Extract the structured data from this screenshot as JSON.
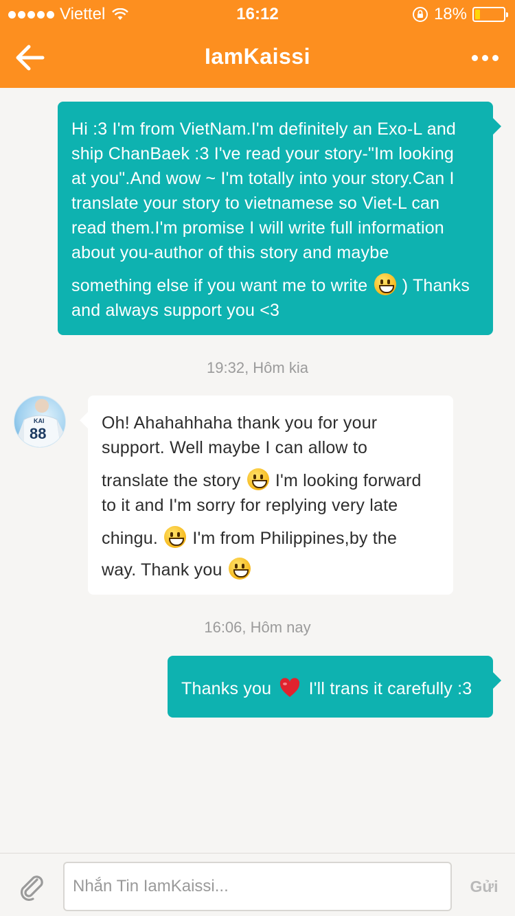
{
  "status_bar": {
    "carrier": "Viettel",
    "time": "16:12",
    "battery": "18%",
    "battery_level": 0.18
  },
  "header": {
    "title": "IamKaissi",
    "back_icon": "arrow-left-icon",
    "more_icon": "ellipsis-icon"
  },
  "messages": [
    {
      "direction": "out",
      "lines": [
        "Hi :3 I'm from VietNam.I'm definitely an Exo-L and",
        "ship ChanBaek :3 I've read your story-\"Im looking",
        "at you\".And wow ~ I'm totally into your story.Can I",
        "translate your story to vietnamese  so Viet-L can",
        "read them.I'm promise I will write full information",
        "about you-author of this story and maybe",
        "something else if you want me to write",
        ") Thanks",
        "and always support you <3"
      ]
    },
    {
      "timestamp": "19:32, Hôm kia"
    },
    {
      "direction": "in",
      "lines": [
        "Oh! Ahahahhaha thank you for your",
        "support. Well maybe I can allow to",
        "translate the story",
        "I'm looking forward",
        "to it and I'm sorry for replying very late",
        "chingu.",
        "I'm from Philippines,by the",
        "way. Thank you"
      ]
    },
    {
      "timestamp": "16:06, Hôm nay"
    },
    {
      "direction": "out",
      "lines": [
        "Thanks you",
        "I'll trans it carefully :3"
      ]
    }
  ],
  "avatar": {
    "name_on_jersey": "KAI",
    "number_on_jersey": "88"
  },
  "input_bar": {
    "placeholder": "Nhắn Tin IamKaissi...",
    "value": "",
    "send_label": "Gửi",
    "attach_icon": "paperclip-icon"
  },
  "colors": {
    "header": "#fd8f1f",
    "outgoing_bubble": "#0eb2b0",
    "incoming_bubble": "#ffffff",
    "background": "#f6f5f3"
  }
}
